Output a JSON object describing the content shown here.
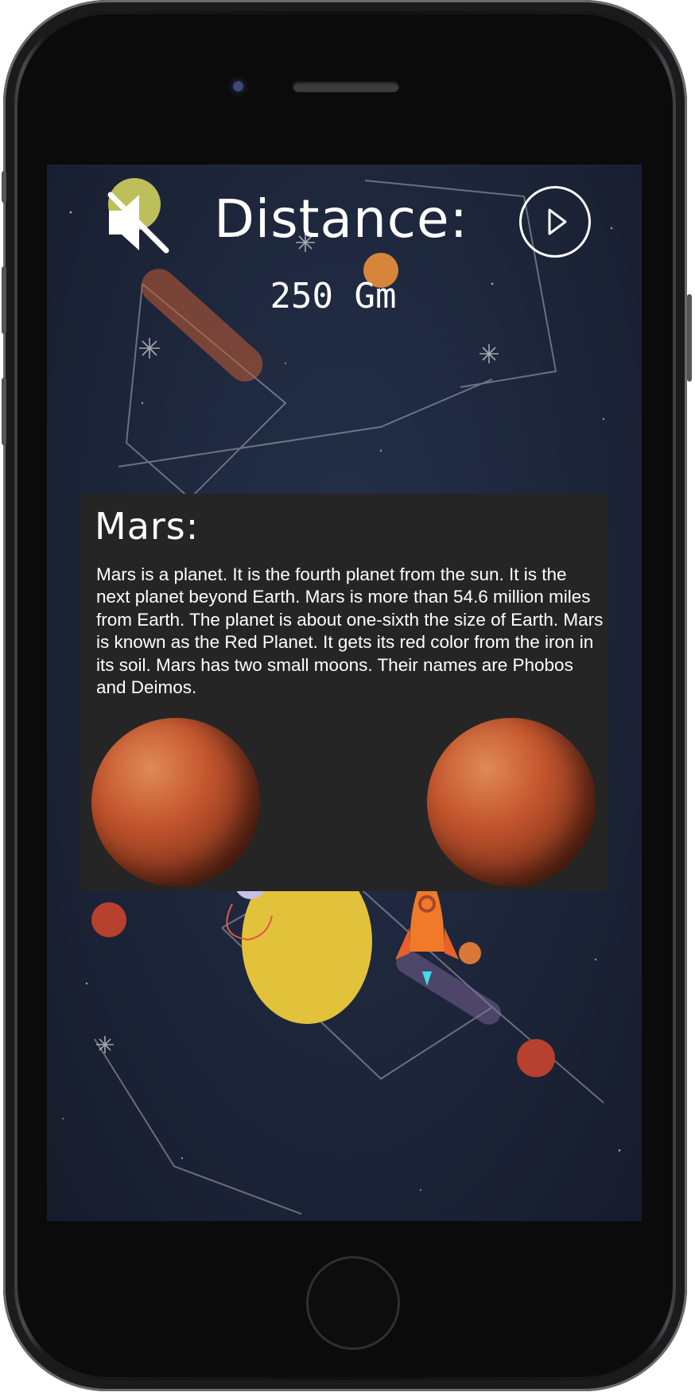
{
  "header": {
    "distance_label": "Distance:",
    "distance_value": "250 Gm",
    "mute_icon": "speaker-muted-icon",
    "play_icon": "play-icon"
  },
  "info": {
    "title": "Mars:",
    "description": "Mars is a planet. It is the fourth planet from the sun. It is the next planet beyond Earth. Mars is more than 54.6 million miles from Earth. The planet is about one-sixth the size of Earth. Mars is known as the Red Planet. It gets its red color from the iron in its soil. Mars has two small moons. Their names are Phobos and Deimos."
  },
  "colors": {
    "background": "#1c2438",
    "card": "#252525",
    "sun": "#e2c23a",
    "mars": "#c4562e",
    "rocket": "#f07a2a"
  }
}
